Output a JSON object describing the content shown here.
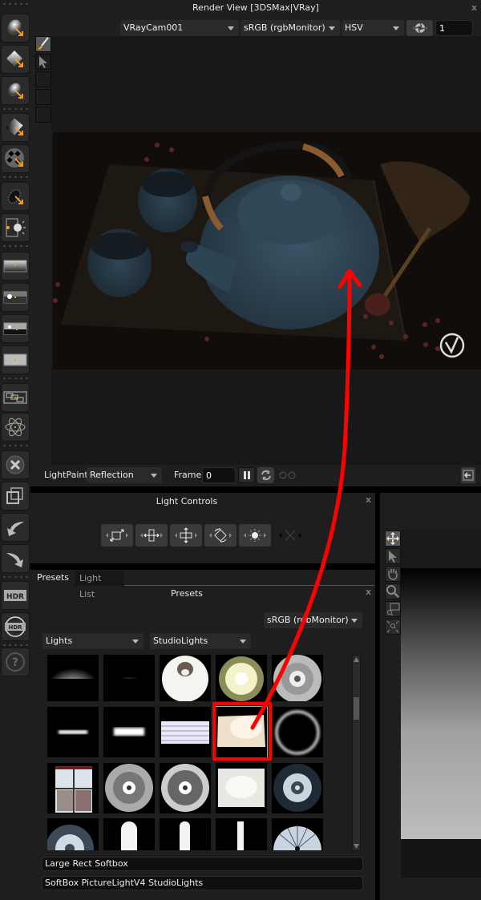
{
  "window": {
    "title": "Render View [3DSMax|VRay]",
    "close_label": "x"
  },
  "toolbar": {
    "camera": "VRayCam001",
    "color_space": "sRGB (rgbMonitor)",
    "color_mode": "HSV",
    "frame_number": "1"
  },
  "left_tools": [
    {
      "name": "spot-light-tool"
    },
    {
      "name": "rect-light-tool"
    },
    {
      "name": "sphere-light-tool"
    },
    {
      "name": "gradient-light-tool"
    },
    {
      "name": "pattern-light-tool"
    },
    {
      "name": "flag-tool"
    },
    {
      "name": "light-source-tool"
    },
    {
      "name": "gradient-bg-tool"
    },
    {
      "name": "hdri-bg-tool"
    },
    {
      "name": "sun-bg-tool"
    },
    {
      "name": "solid-bg-tool"
    },
    {
      "name": "group-tool"
    },
    {
      "name": "atom-tool"
    },
    {
      "name": "delete-tool"
    },
    {
      "name": "duplicate-tool"
    },
    {
      "name": "undo-tool"
    },
    {
      "name": "redo-tool"
    },
    {
      "name": "hdr-tool",
      "label": "HDR"
    },
    {
      "name": "hdr-refresh-tool",
      "label": "HDR"
    },
    {
      "name": "help-tool",
      "label": "?"
    }
  ],
  "light_paint": {
    "label": "LightPaint",
    "mode": "Reflection",
    "frame_label": "Frame",
    "frame_value": "0"
  },
  "light_controls": {
    "title": "Light Controls",
    "buttons": [
      "scale",
      "width",
      "height",
      "rotate",
      "intensity",
      "disabled-scale"
    ]
  },
  "presets": {
    "tabs": [
      {
        "label": "Presets",
        "active": true
      },
      {
        "label": "Light List",
        "active": false
      }
    ],
    "title": "Presets",
    "color_space": "sRGB (rgbMonitor)",
    "category": "Lights",
    "library": "StudioLights",
    "selected_index": 8,
    "selected_name": "Large Rect Softbox",
    "selected_path": "SoftBox PictureLightV4 StudioLights",
    "thumbs": [
      "strip-top-wide",
      "strip-top-small",
      "ring-bulb",
      "honeycomb-reflector",
      "beauty-dish",
      "bar-thin",
      "bar-thick",
      "fluorescent-bank",
      "large-rect-softbox",
      "ring-light",
      "window",
      "dish-gray",
      "dish-silver",
      "softbox-white",
      "dish-dark",
      "dish-partial",
      "strip-rounded-wide",
      "strip-rounded-narrow",
      "strip-thin",
      "umbrella"
    ]
  },
  "accent": {
    "highlight": "#ff0000",
    "orange": "#f39a1c"
  }
}
